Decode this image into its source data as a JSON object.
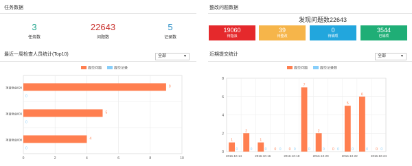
{
  "task_stats": {
    "title": "任务数据",
    "items": [
      {
        "value": "3",
        "label": "任务数",
        "color": "#1fa58c"
      },
      {
        "value": "22643",
        "label": "问题数",
        "color": "#c9302c"
      },
      {
        "value": "5",
        "label": "记录数",
        "color": "#2a8fc7"
      }
    ]
  },
  "rectify_stats": {
    "title": "整改问题数据",
    "headline": "发现问题数22643",
    "tiles": [
      {
        "value": "19060",
        "label": "待指派",
        "color": "#e5292c"
      },
      {
        "value": "39",
        "label": "待整改",
        "color": "#f6b54a"
      },
      {
        "value": "0",
        "label": "待销项",
        "color": "#22a6dd"
      },
      {
        "value": "3544",
        "label": "已销项",
        "color": "#1fae76"
      }
    ]
  },
  "inspector_panel": {
    "title": "最近一周检查人员统计(Top10)",
    "filter": {
      "selected": "全部"
    }
  },
  "recent_panel": {
    "title": "近期提交统计",
    "filter": {
      "selected": "全部"
    }
  },
  "chart_data": [
    {
      "type": "bar",
      "orientation": "horizontal",
      "categories": [
        "项目物业020",
        "项目物业003",
        "项目物业008"
      ],
      "series": [
        {
          "name": "提交问题",
          "values": [
            9,
            5,
            4
          ],
          "color": "#ff7f50"
        },
        {
          "name": "提交记录",
          "values": [
            0,
            0,
            0
          ],
          "color": "#87cefa"
        }
      ],
      "xlim": [
        0,
        10
      ],
      "xticks": [
        "0",
        "2",
        "4",
        "6",
        "8",
        "10"
      ],
      "grid": true,
      "legend": "top-center"
    },
    {
      "type": "bar",
      "categories": [
        "2016-10-14",
        "",
        "2016-10-16",
        "",
        "2016-10-18",
        "",
        "2016-10-20",
        "",
        "2016-10-22",
        "",
        "2016-10-24"
      ],
      "series": [
        {
          "name": "提交问题",
          "values": [
            1,
            2,
            1,
            0,
            0,
            7,
            2,
            0,
            5,
            6,
            0
          ],
          "color": "#ff7f50"
        },
        {
          "name": "提交记录数",
          "values": [
            0,
            0,
            0,
            0,
            0,
            0,
            0,
            0,
            0,
            0,
            0
          ],
          "color": "#87cefa"
        }
      ],
      "xticks": [
        "2016-10-14",
        "2016-10-16",
        "2016-10-18",
        "2016-10-20",
        "2016-10-22",
        "2016-10-24"
      ],
      "ylim": [
        0,
        8
      ],
      "yticks": [
        "0",
        "2",
        "4",
        "6",
        "8"
      ],
      "grid": true,
      "legend": "top-center"
    }
  ]
}
